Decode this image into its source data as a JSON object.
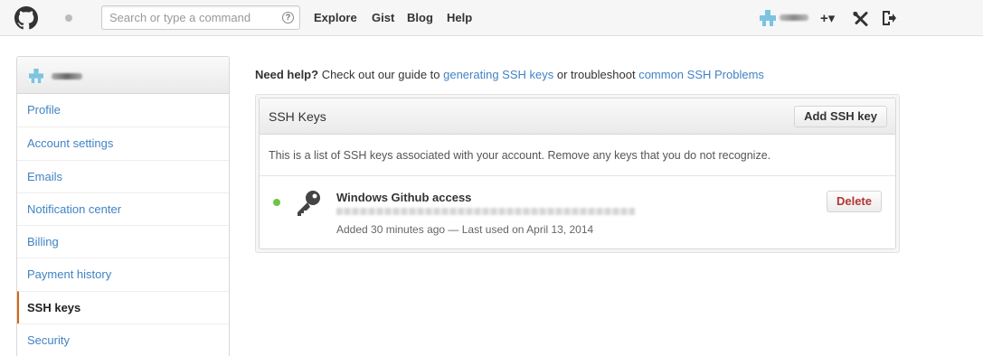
{
  "header": {
    "search_placeholder": "Search or type a command",
    "search_help": "?",
    "nav": [
      "Explore",
      "Gist",
      "Blog",
      "Help"
    ],
    "create_label": "+▾"
  },
  "sidebar": {
    "items": [
      {
        "label": "Profile"
      },
      {
        "label": "Account settings"
      },
      {
        "label": "Emails"
      },
      {
        "label": "Notification center"
      },
      {
        "label": "Billing"
      },
      {
        "label": "Payment history"
      },
      {
        "label": "SSH keys",
        "selected": true
      },
      {
        "label": "Security"
      }
    ]
  },
  "help": {
    "bold": "Need help?",
    "text1": " Check out our guide to ",
    "link1": "generating SSH keys",
    "text2": " or troubleshoot ",
    "link2": "common SSH Problems"
  },
  "ssh": {
    "title": "SSH Keys",
    "add_button": "Add SSH key",
    "description": "This is a list of SSH keys associated with your account. Remove any keys that you do not recognize.",
    "keys": [
      {
        "title": "Windows Github access",
        "added": "Added 30 minutes ago — Last used on April 13, 2014",
        "delete_label": "Delete"
      }
    ]
  },
  "colors": {
    "link": "#4183c4",
    "selected_marker": "#d26911",
    "active_dot": "#6cc644",
    "delete_text": "#b33630"
  }
}
